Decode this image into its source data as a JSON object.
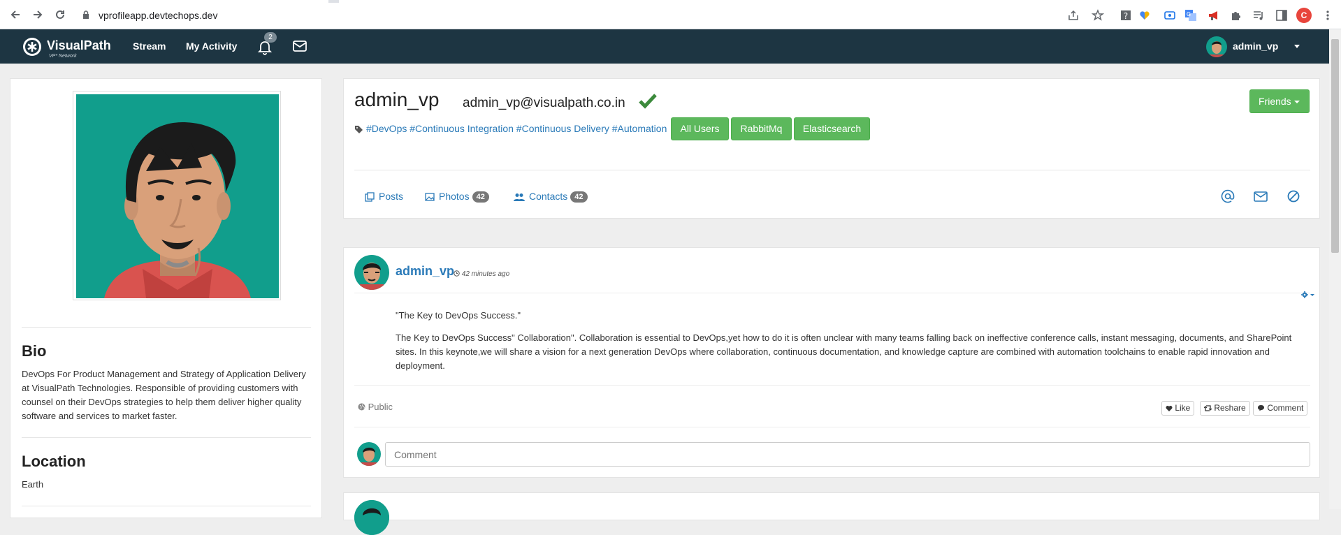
{
  "browser": {
    "url": "vprofileapp.devtechops.dev",
    "profile_initial": "C"
  },
  "navbar": {
    "brand": "VisualPath",
    "brand_sub": "VP* Network",
    "links": [
      "Stream",
      "My Activity"
    ],
    "notification_count": "2",
    "user": "admin_vp"
  },
  "profile": {
    "username": "admin_vp",
    "email": "admin_vp@visualpath.co.in",
    "tags": "#DevOps #Continuous Integration #Continuous Delivery #Automation",
    "buttons": [
      "All Users",
      "RabbitMq",
      "Elasticsearch"
    ],
    "friends_label": "Friends",
    "tabs": {
      "posts": "Posts",
      "photos": "Photos",
      "photos_count": "42",
      "contacts": "Contacts",
      "contacts_count": "42"
    }
  },
  "sidebar": {
    "bio_title": "Bio",
    "bio_text": "DevOps For Product Management and Strategy of Application Delivery at VisualPath Technologies. Responsible of providing customers with counsel on their DevOps strategies to help them deliver higher quality software and services to market faster.",
    "location_title": "Location",
    "location": "Earth"
  },
  "post": {
    "author": "admin_vp",
    "time": "42 minutes ago",
    "title": "\"The Key to DevOps Success.\"",
    "body": "The Key to DevOps Success\" Collaboration\". Collaboration is essential to DevOps,yet how to do it is often unclear with many teams falling back on ineffective conference calls, instant messaging, documents, and SharePoint sites. In this keynote,we will share a vision for a next generation DevOps where collaboration, continuous documentation, and knowledge capture are combined with automation toolchains to enable rapid innovation and deployment.",
    "visibility": "Public",
    "actions": [
      "Like",
      "Reshare",
      "Comment"
    ],
    "comment_placeholder": "Comment"
  },
  "colors": {
    "navbar": "#1d3542",
    "accent_green": "#5cb85c",
    "link_blue": "#2a7ab8",
    "avatar_teal": "#119e8c"
  }
}
